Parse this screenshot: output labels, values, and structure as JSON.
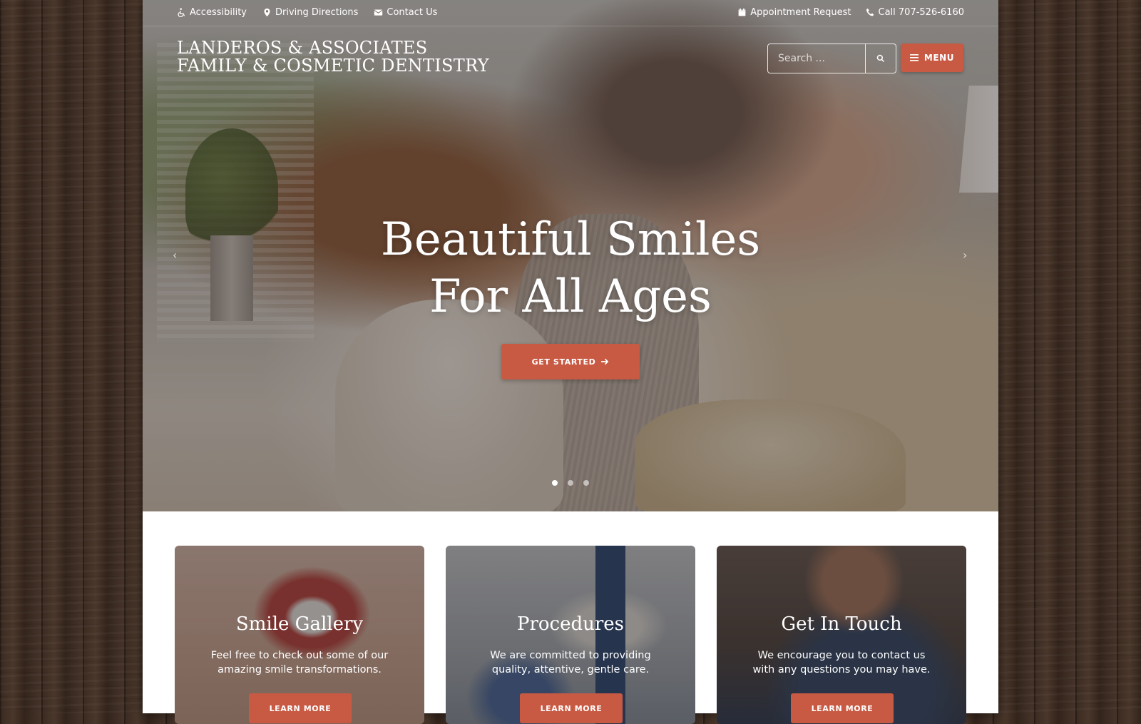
{
  "topbar": {
    "left": [
      {
        "label": "Accessibility",
        "icon": "wheelchair-icon"
      },
      {
        "label": "Driving Directions",
        "icon": "map-marker-icon"
      },
      {
        "label": "Contact Us",
        "icon": "envelope-icon"
      }
    ],
    "right": [
      {
        "label": "Appointment Request",
        "icon": "calendar-icon"
      },
      {
        "label": "Call 707-526-6160",
        "icon": "phone-icon"
      }
    ]
  },
  "brand": {
    "line1": "LANDEROS & ASSOCIATES",
    "line2": "FAMILY & COSMETIC DENTISTRY"
  },
  "search": {
    "placeholder": "Search ...",
    "icon": "search-icon"
  },
  "menu": {
    "label": "MENU",
    "icon": "hamburger-icon"
  },
  "hero": {
    "headline_line1": "Beautiful Smiles",
    "headline_line2": "For All Ages",
    "cta_label": "GET STARTED",
    "cta_icon": "arrow-right-icon",
    "prev_glyph": "‹",
    "next_glyph": "›",
    "slide_count": 3,
    "active_slide": 1
  },
  "cards": [
    {
      "title": "Smile Gallery",
      "text": "Feel free to check out some of our amazing smile transformations.",
      "button": "LEARN MORE"
    },
    {
      "title": "Procedures",
      "text": "We are committed to providing quality, attentive, gentle care.",
      "button": "LEARN MORE"
    },
    {
      "title": "Get In Touch",
      "text": "We encourage you to contact us with any questions you may have.",
      "button": "LEARN MORE"
    }
  ],
  "colors": {
    "accent": "#c85a44",
    "background_wood": "#3a2a20",
    "text_light": "#ffffff"
  }
}
